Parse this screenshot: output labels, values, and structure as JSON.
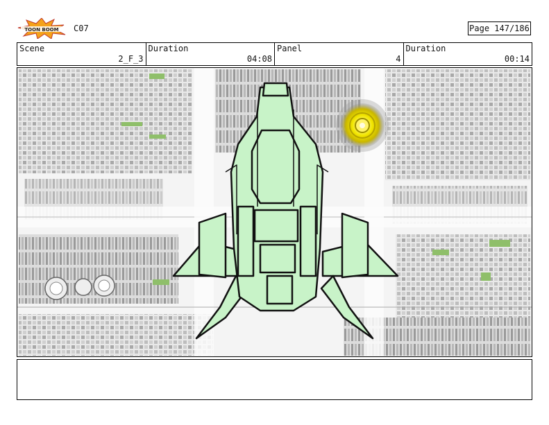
{
  "logo": {
    "text": "TOON BOOM"
  },
  "sequence_code": "C07",
  "page_label": "Page 147/186",
  "header": {
    "scene_label": "Scene",
    "scene_value": "2_F_3",
    "duration_label": "Duration",
    "duration_value": "04:08",
    "panel_label": "Panel",
    "panel_value": "4",
    "panel_duration_label": "Duration",
    "panel_duration_value": "00:14"
  },
  "colors": {
    "ship_fill": "#c8f3c8",
    "ship_stroke": "#111111",
    "city_light": "#eeeeee",
    "city_mid": "#bdbdbd",
    "city_dark": "#8c8c8c",
    "park_green": "#8fbf6a",
    "glow_yellow": "#f2e600"
  },
  "notes_text": ""
}
